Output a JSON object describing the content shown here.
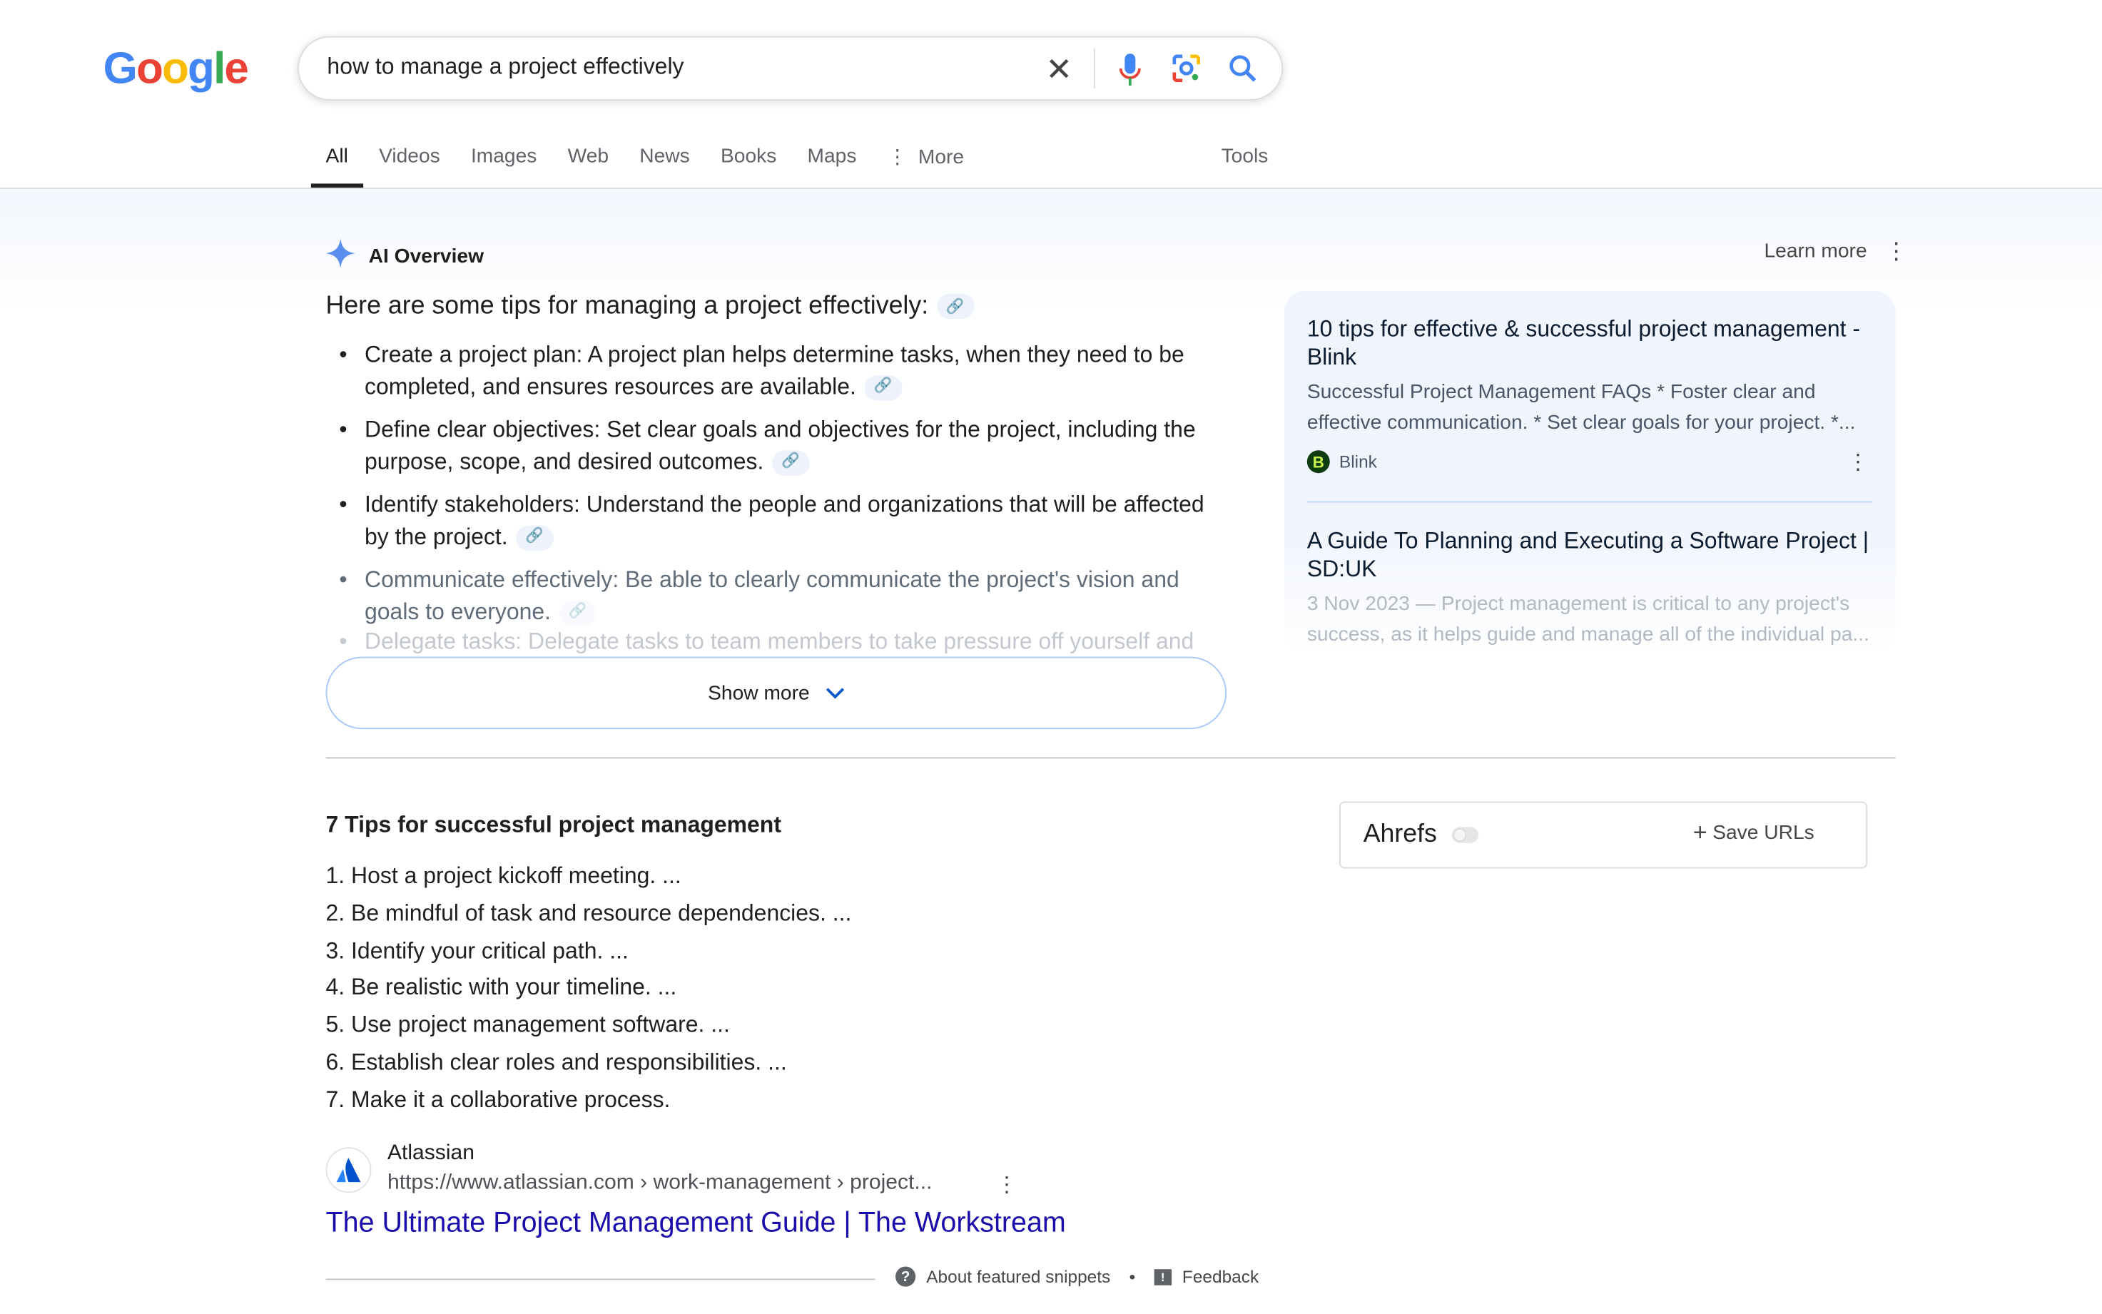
{
  "logo": "Google",
  "search": {
    "query": "how to manage a project effectively"
  },
  "tabs": [
    "All",
    "Videos",
    "Images",
    "Web",
    "News",
    "Books",
    "Maps",
    "More"
  ],
  "tools": "Tools",
  "ai_overview": {
    "label": "AI Overview",
    "learn_more": "Learn more",
    "title": "Here are some tips for managing a project effectively:",
    "bullets": [
      "Create a project plan: A project plan helps determine tasks, when they need to be completed, and ensures resources are available.",
      "Define clear objectives: Set clear goals and objectives for the project, including the purpose, scope, and desired outcomes.",
      "Identify stakeholders: Understand the people and organizations that will be affected by the project.",
      "Communicate effectively: Be able to clearly communicate the project's vision and goals to everyone.",
      "Delegate tasks: Delegate tasks to team members to take pressure off yourself and"
    ],
    "show_more": "Show more",
    "sources": [
      {
        "title": "10 tips for effective & successful project management - Blink",
        "snippet": "Successful Project Management FAQs * Foster clear and effective communication. * Set clear goals for your project. *...",
        "site": "Blink",
        "favicon": "B"
      },
      {
        "title": "A Guide To Planning and Executing a Software Project | SD:UK",
        "snippet": "3 Nov 2023 — Project management is critical to any project's success, as it helps guide and manage all of the individual pa..."
      }
    ]
  },
  "snippet": {
    "heading": "7 Tips for successful project management",
    "items": [
      "1. Host a project kickoff meeting. ...",
      "2. Be mindful of task and resource dependencies. ...",
      "3. Identify your critical path. ...",
      "4. Be realistic with your timeline. ...",
      "5. Use project management software. ...",
      "6. Establish clear roles and responsibilities. ...",
      "7. Make it a collaborative process."
    ],
    "source_name": "Atlassian",
    "source_url": "https://www.atlassian.com › work-management › project...",
    "link_title": "The Ultimate Project Management Guide | The Workstream",
    "about": "About featured snippets",
    "dot": "•",
    "feedback": "Feedback"
  },
  "ahrefs": {
    "label": "Ahrefs",
    "save": "Save URLs"
  },
  "colors": {
    "link": "#1a0dab",
    "accent": "#1a73e8"
  }
}
